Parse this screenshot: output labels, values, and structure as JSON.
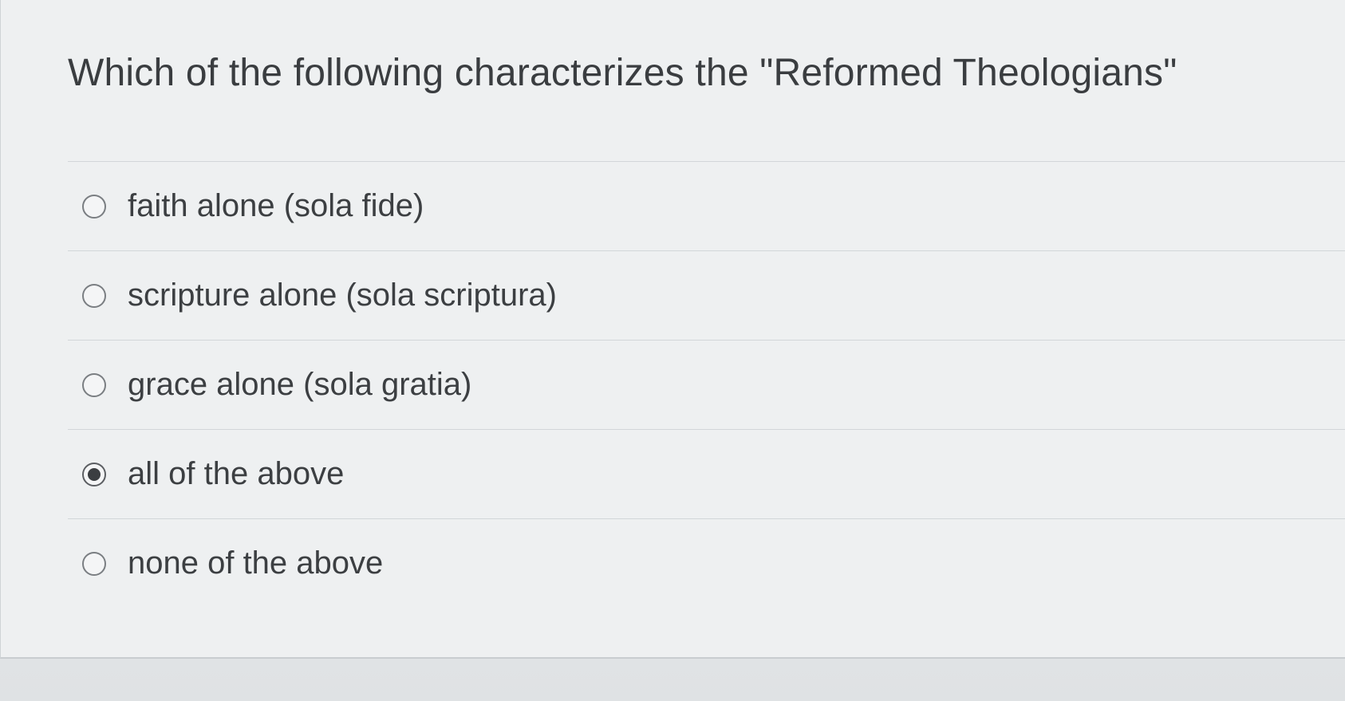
{
  "question": {
    "text": "Which of the following characterizes the \"Reformed Theologians\""
  },
  "answers": [
    {
      "label": "faith alone (sola fide)",
      "selected": false
    },
    {
      "label": "scripture alone (sola scriptura)",
      "selected": false
    },
    {
      "label": "grace alone (sola gratia)",
      "selected": false
    },
    {
      "label": "all of the above",
      "selected": true
    },
    {
      "label": "none of the above",
      "selected": false
    }
  ]
}
